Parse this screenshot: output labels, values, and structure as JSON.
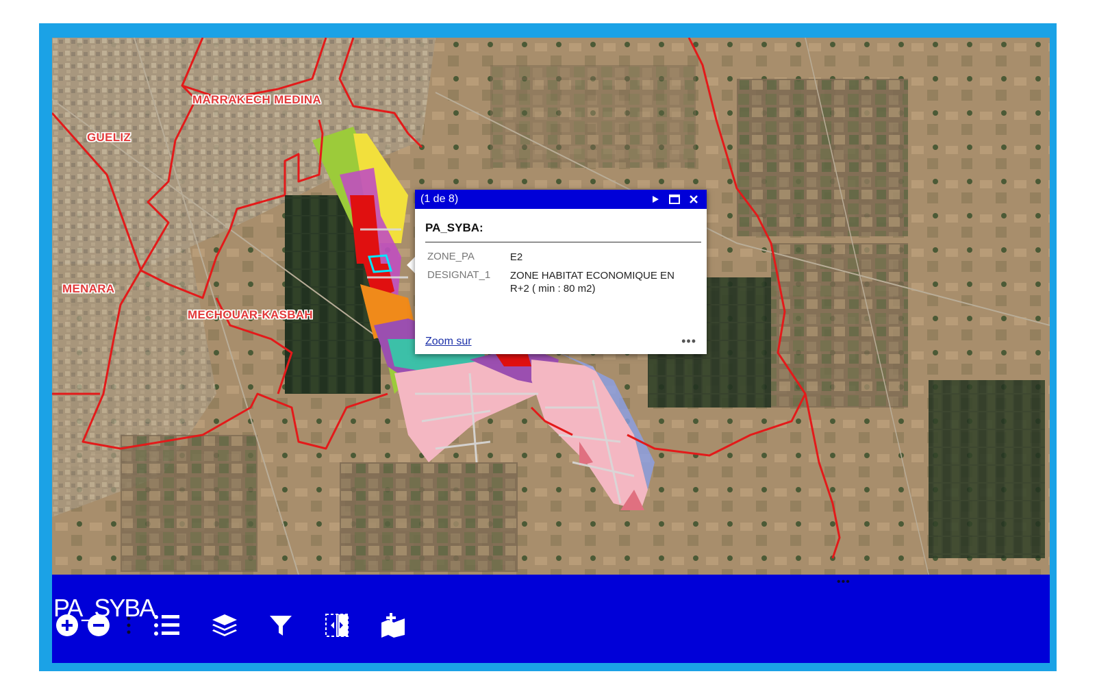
{
  "map": {
    "district_labels": [
      {
        "name": "MARRAKECH MEDINA"
      },
      {
        "name": "GUELIZ"
      },
      {
        "name": "MENARA"
      },
      {
        "name": "MECHOUAR-KASBAH"
      }
    ]
  },
  "popup": {
    "counter": "(1 de 8)",
    "title": "PA_SYBA:",
    "fields": [
      {
        "key": "ZONE_PA",
        "value": "E2"
      },
      {
        "key": "DESIGNAT_1",
        "value": "ZONE HABITAT ECONOMIQUE EN R+2 ( min : 80 m2)"
      }
    ],
    "zoom_link": "Zoom sur",
    "more": "•••"
  },
  "panel": {
    "title": "PA_SYBA",
    "handle": "•••"
  },
  "toolbar": {
    "icons": [
      "zoom-in-icon",
      "zoom-out-icon",
      "vertical-ellipsis-icon",
      "legend-list-icon",
      "layers-icon",
      "filter-icon",
      "split-view-icon",
      "add-data-icon"
    ]
  },
  "colors": {
    "frame": "#1ba2e6",
    "panel": "#0000d8",
    "boundary": "#e31a1a",
    "zone_pink": "#f4b7c2",
    "zone_yellow": "#f2e03c",
    "zone_green": "#9ccb3a",
    "zone_red": "#e01010",
    "zone_purple": "#9b4fb0",
    "zone_teal": "#3cc0a8"
  }
}
